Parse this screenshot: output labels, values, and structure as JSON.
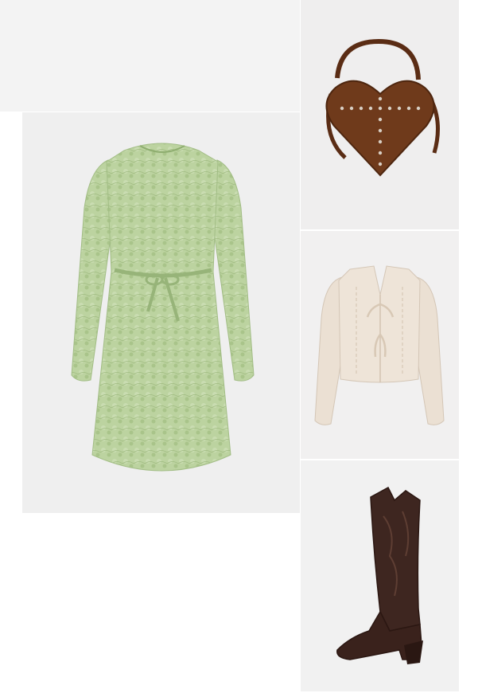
{
  "collage": {
    "items": [
      {
        "id": "dress",
        "icon": "lace-dress-icon",
        "color": "#b7cf9a"
      },
      {
        "id": "bag",
        "icon": "heart-bag-icon",
        "color": "#6e3a1a"
      },
      {
        "id": "cardigan",
        "icon": "cardigan-icon",
        "color": "#eadfd2"
      },
      {
        "id": "boot",
        "icon": "cowboy-boot-icon",
        "color": "#3e2620"
      }
    ]
  }
}
